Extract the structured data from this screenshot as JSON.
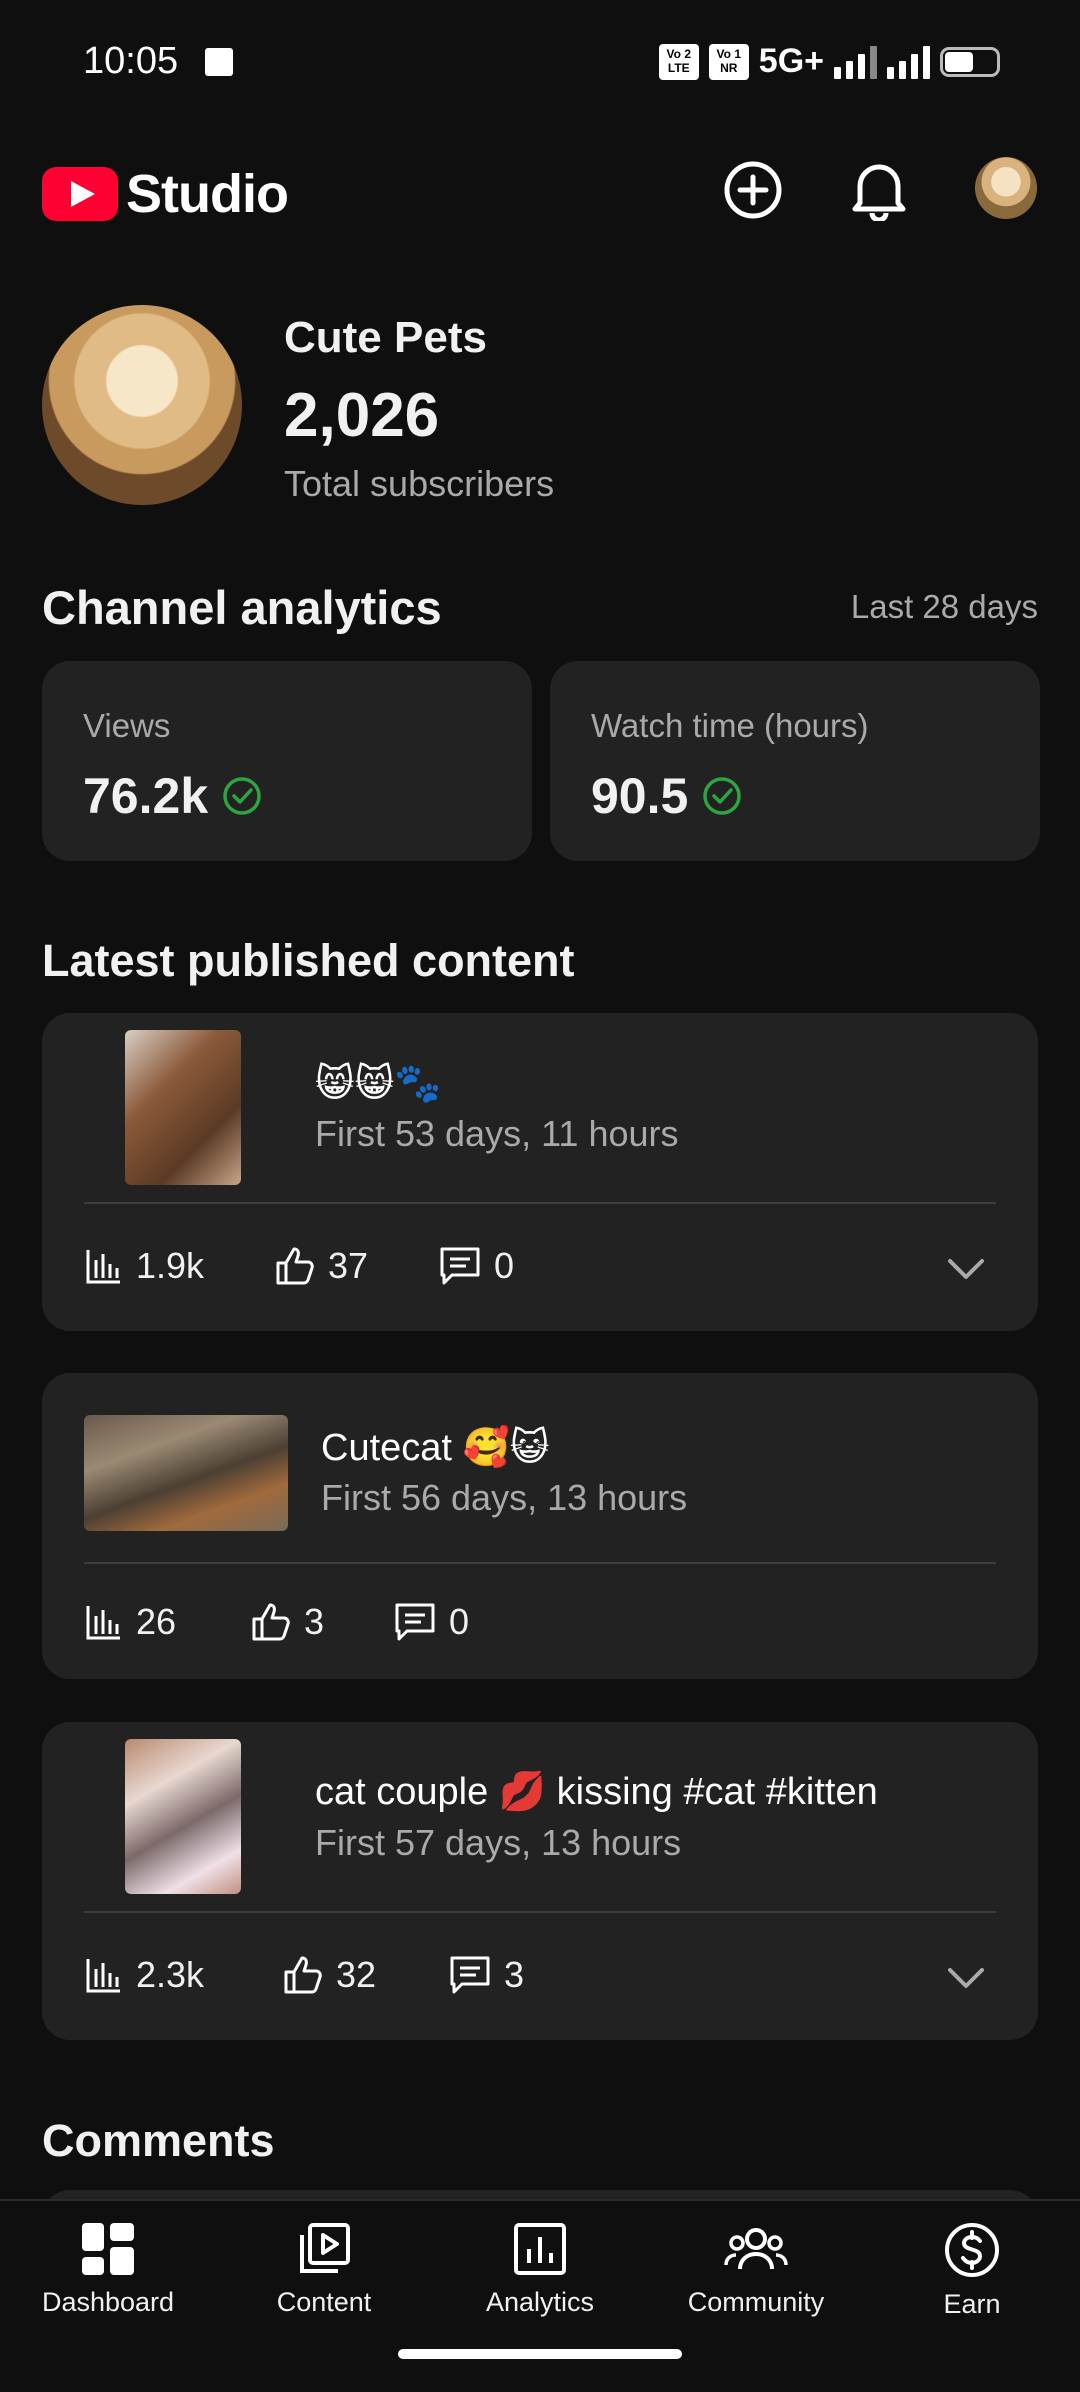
{
  "status_bar": {
    "time": "10:05",
    "sim1": "Vo LTE 2",
    "sim2": "Vo NR 1",
    "network": "5G+"
  },
  "header": {
    "app_name": "Studio",
    "icons": [
      "create-icon",
      "bell-icon",
      "avatar"
    ]
  },
  "channel": {
    "name": "Cute Pets",
    "subscribers": "2,026",
    "subscribers_label": "Total subscribers"
  },
  "analytics": {
    "title": "Channel analytics",
    "range": "Last 28 days",
    "cards": [
      {
        "label": "Views",
        "value": "76.2k"
      },
      {
        "label": "Watch time (hours)",
        "value": "90.5"
      }
    ]
  },
  "latest": {
    "title": "Latest published content",
    "items": [
      {
        "title": "😸😸🐾",
        "sub": "First 53 days, 11 hours",
        "views": "1.9k",
        "likes": "37",
        "comments": "0"
      },
      {
        "title": "Cutecat 🥰😺",
        "sub": "First 56 days, 13 hours",
        "views": "26",
        "likes": "3",
        "comments": "0"
      },
      {
        "title": "cat couple 💋 kissing #cat #kitten",
        "sub": "First 57 days, 13 hours",
        "views": "2.3k",
        "likes": "32",
        "comments": "3"
      }
    ]
  },
  "comments": {
    "title": "Comments"
  },
  "nav": [
    {
      "label": "Dashboard"
    },
    {
      "label": "Content"
    },
    {
      "label": "Analytics"
    },
    {
      "label": "Community"
    },
    {
      "label": "Earn"
    }
  ],
  "colors": {
    "accent": "#ff0033",
    "check": "#2ba640",
    "background": "#0f0f0f",
    "card": "#222222"
  }
}
